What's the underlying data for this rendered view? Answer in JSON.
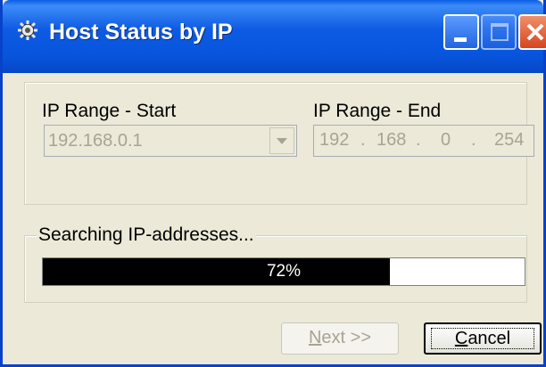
{
  "window": {
    "title": "Host Status by IP",
    "icon": "gear-icon",
    "controls": [
      "minimize-icon",
      "maximize-icon",
      "close-icon"
    ]
  },
  "range": {
    "start_label": "IP Range - Start",
    "start_value": "192.168.0.1",
    "end_label": "IP Range - End",
    "end_octets": [
      "192",
      "168",
      "0",
      "254"
    ]
  },
  "search": {
    "label": "Searching IP-addresses...",
    "progress_percent": 72,
    "progress_text": "72%"
  },
  "buttons": {
    "next_mnemonic": "N",
    "next_rest": "ext >>",
    "cancel_mnemonic": "C",
    "cancel_rest": "ancel"
  },
  "colors": {
    "titlebar": "#0855DD",
    "close_button": "#D5451F",
    "dialog_bg": "#ECE9D8",
    "progress_fill": "#000000"
  }
}
